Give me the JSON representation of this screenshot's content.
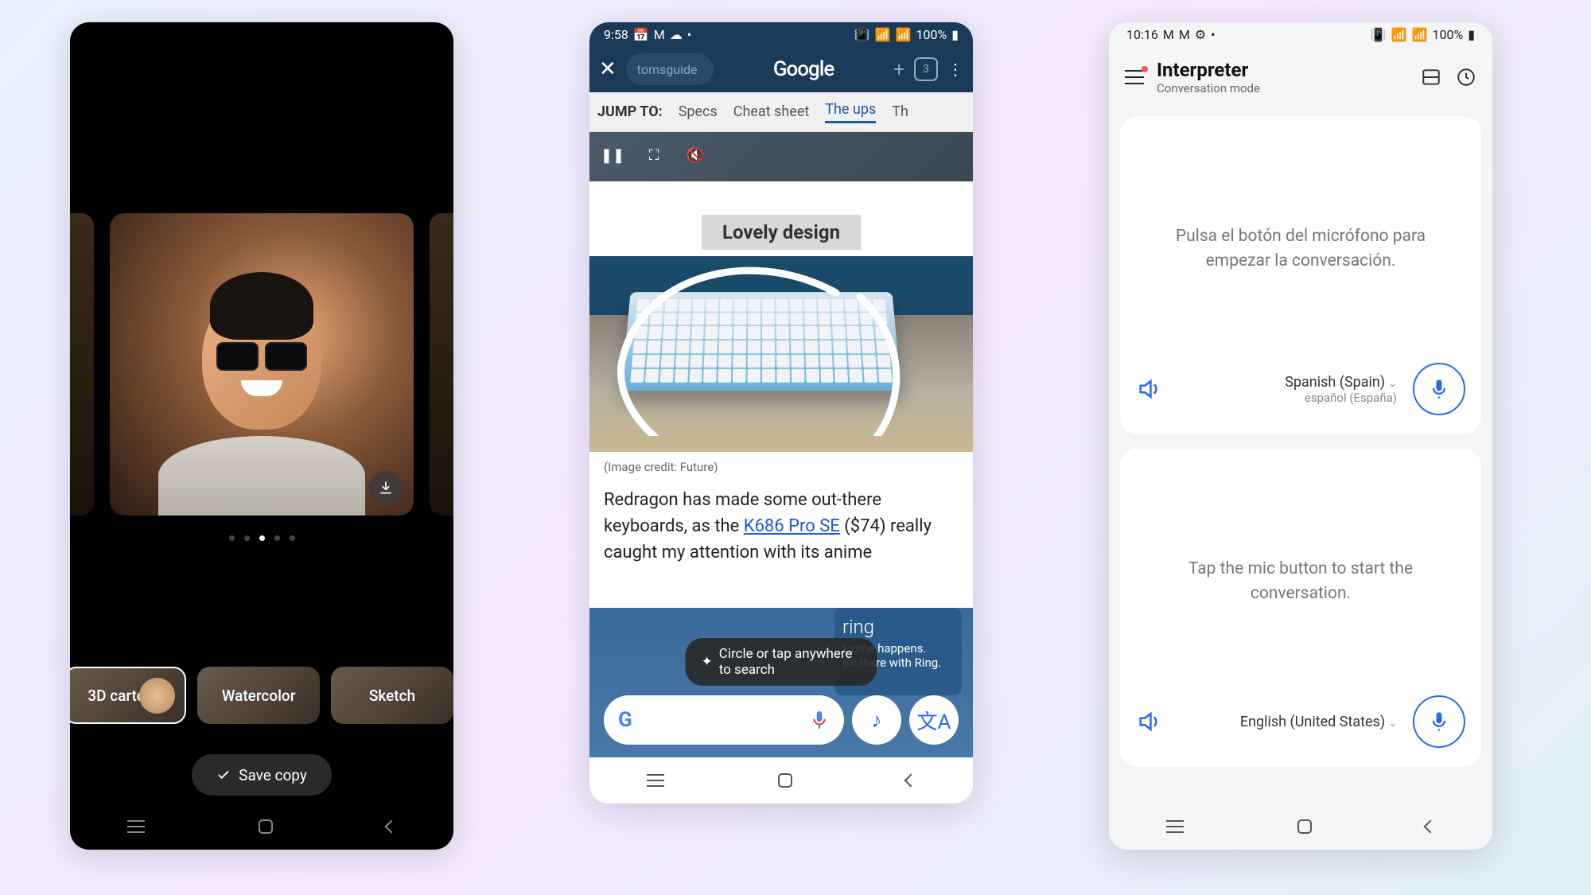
{
  "phone1": {
    "carousel": {
      "total_dots": 5,
      "active_index": 2
    },
    "download_label": "download",
    "styles": [
      {
        "label": "3D cartoon",
        "selected": true
      },
      {
        "label": "Watercolor",
        "selected": false
      },
      {
        "label": "Sketch",
        "selected": false
      }
    ],
    "save_button": "Save copy"
  },
  "phone2": {
    "status": {
      "time": "9:58",
      "battery": "100%"
    },
    "bar": {
      "url_text": "tomsguide",
      "tab_count": "3",
      "logo": "Google"
    },
    "jump": {
      "label": "JUMP TO:",
      "items": [
        "Specs",
        "Cheat sheet",
        "The ups",
        "Th"
      ],
      "active_index": 2
    },
    "article": {
      "heading": "Lovely design",
      "credit": "(Image credit: Future)",
      "text_pre": "Redragon has made some out-there keyboards, as the ",
      "link_text": "K686 Pro SE",
      "text_post": " ($74) really caught my attention with its anime"
    },
    "overlay": {
      "ring": {
        "logo": "ring",
        "line1": "Home happens.",
        "line2": "Be there with Ring."
      },
      "hint": "Circle or tap anywhere to search"
    }
  },
  "phone3": {
    "status": {
      "time": "10:16",
      "battery": "100%"
    },
    "header": {
      "title": "Interpreter",
      "subtitle": "Conversation mode"
    },
    "pane_top": {
      "prompt": "Pulsa el botón del micrófono para empezar la conversación.",
      "lang_main": "Spanish (Spain)",
      "lang_sub": "español (España)"
    },
    "pane_bottom": {
      "prompt": "Tap the mic button to start the conversation.",
      "lang_main": "English (United States)"
    }
  }
}
